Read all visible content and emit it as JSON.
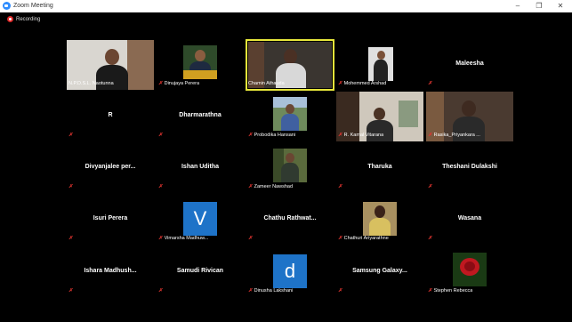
{
  "window": {
    "title": "Zoom Meeting",
    "controls": [
      "–",
      "❐",
      "✕"
    ]
  },
  "recording_label": "Recording",
  "mute_glyph": "✗",
  "colors": {
    "accent_active": "#e6e63a",
    "muted": "#e0342f",
    "avatar_blue": "#1e73c8"
  },
  "participants": [
    {
      "name": "N.P.D.S.L. Naotunna"
    },
    {
      "name": "Dinujaya Perera"
    },
    {
      "name": "Chamin Athauda"
    },
    {
      "name": "Mohemmed Arshad"
    },
    {
      "name": "Maleesha"
    },
    {
      "name": "R"
    },
    {
      "name": "Dharmarathna"
    },
    {
      "name": "Probodika Hansani"
    },
    {
      "name": "R. Kamal Vitarana"
    },
    {
      "name": "Rasika_Priyankara ..."
    },
    {
      "name": "Divyanjalee per..."
    },
    {
      "name": "Ishan Uditha"
    },
    {
      "name": "Zameer Nawshad"
    },
    {
      "name": "Tharuka"
    },
    {
      "name": "Theshani Dulakshi"
    },
    {
      "name": "Isuri Perera"
    },
    {
      "name": "Vimarsha Madhuw...",
      "avatar_letter": "V"
    },
    {
      "name": "Chathu Rathwat..."
    },
    {
      "name": "Chathuri Ariyarathne"
    },
    {
      "name": "Wasana"
    },
    {
      "name": "Ishara Madhush..."
    },
    {
      "name": "Samudi Rivican"
    },
    {
      "name": "Dinusha Lakshani",
      "avatar_letter": "d"
    },
    {
      "name": "Samsung Galaxy..."
    },
    {
      "name": "Stephen Rebecca"
    }
  ]
}
